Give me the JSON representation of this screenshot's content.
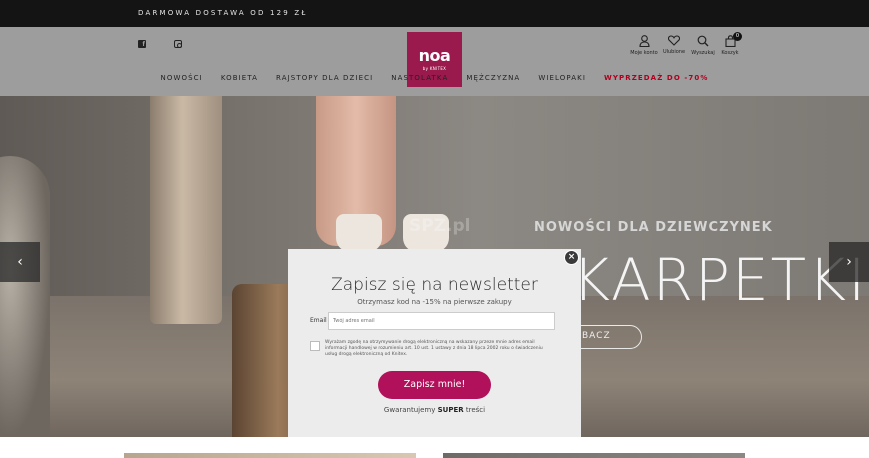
{
  "topbar": {
    "promo": "DARMOWA DOSTAWA OD 129 ZŁ"
  },
  "logo": {
    "brand": "noa",
    "sub": "by KNITEX"
  },
  "social": {
    "facebook": "facebook-icon",
    "instagram": "instagram-icon"
  },
  "header_icons": [
    {
      "icon": "user-icon",
      "label": "Moje konto"
    },
    {
      "icon": "heart-icon",
      "label": "Ulubione"
    },
    {
      "icon": "search-icon",
      "label": "Wyszukaj"
    },
    {
      "icon": "bag-icon",
      "label": "Koszyk",
      "badge": "0"
    }
  ],
  "nav": [
    {
      "label": "NOWOŚCI"
    },
    {
      "label": "KOBIETA"
    },
    {
      "label": "RAJSTOPY DLA DZIECI"
    },
    {
      "label": "NASTOLATKA"
    },
    {
      "label": "MĘŻCZYZNA"
    },
    {
      "label": "WIELOPAKI"
    },
    {
      "label": "WYPRZEDAŻ DO -70%",
      "highlight": true
    }
  ],
  "hero": {
    "subtitle": "NOWOŚCI DLA DZIEWCZYNEK",
    "title": "KARPETKI",
    "button": "BACZ",
    "watermark": "SPZ.pl",
    "prev": "‹",
    "next": "›"
  },
  "modal": {
    "close": "×",
    "title": "Zapisz się na newsletter",
    "subtitle": "Otrzymasz kod na -15% na pierwsze zakupy",
    "email_label": "Email",
    "email_placeholder": "Twój adres email",
    "consent": "Wyrażam zgodę na otrzymywanie drogą elektroniczną na wskazany przeze mnie adres email informacji handlowej w rozumieniu art. 10 ust. 1 ustawy z dnia 18 lipca 2002 roku o świadczeniu usług drogą elektroniczną od Knitex.",
    "submit": "Zapisz mnie!",
    "footer_pre": "Gwarantujemy",
    "footer_bold": "SUPER",
    "footer_post": "treści"
  },
  "colors": {
    "brand": "#9b1a4e",
    "button": "#b0115a",
    "sale": "#b00020"
  }
}
